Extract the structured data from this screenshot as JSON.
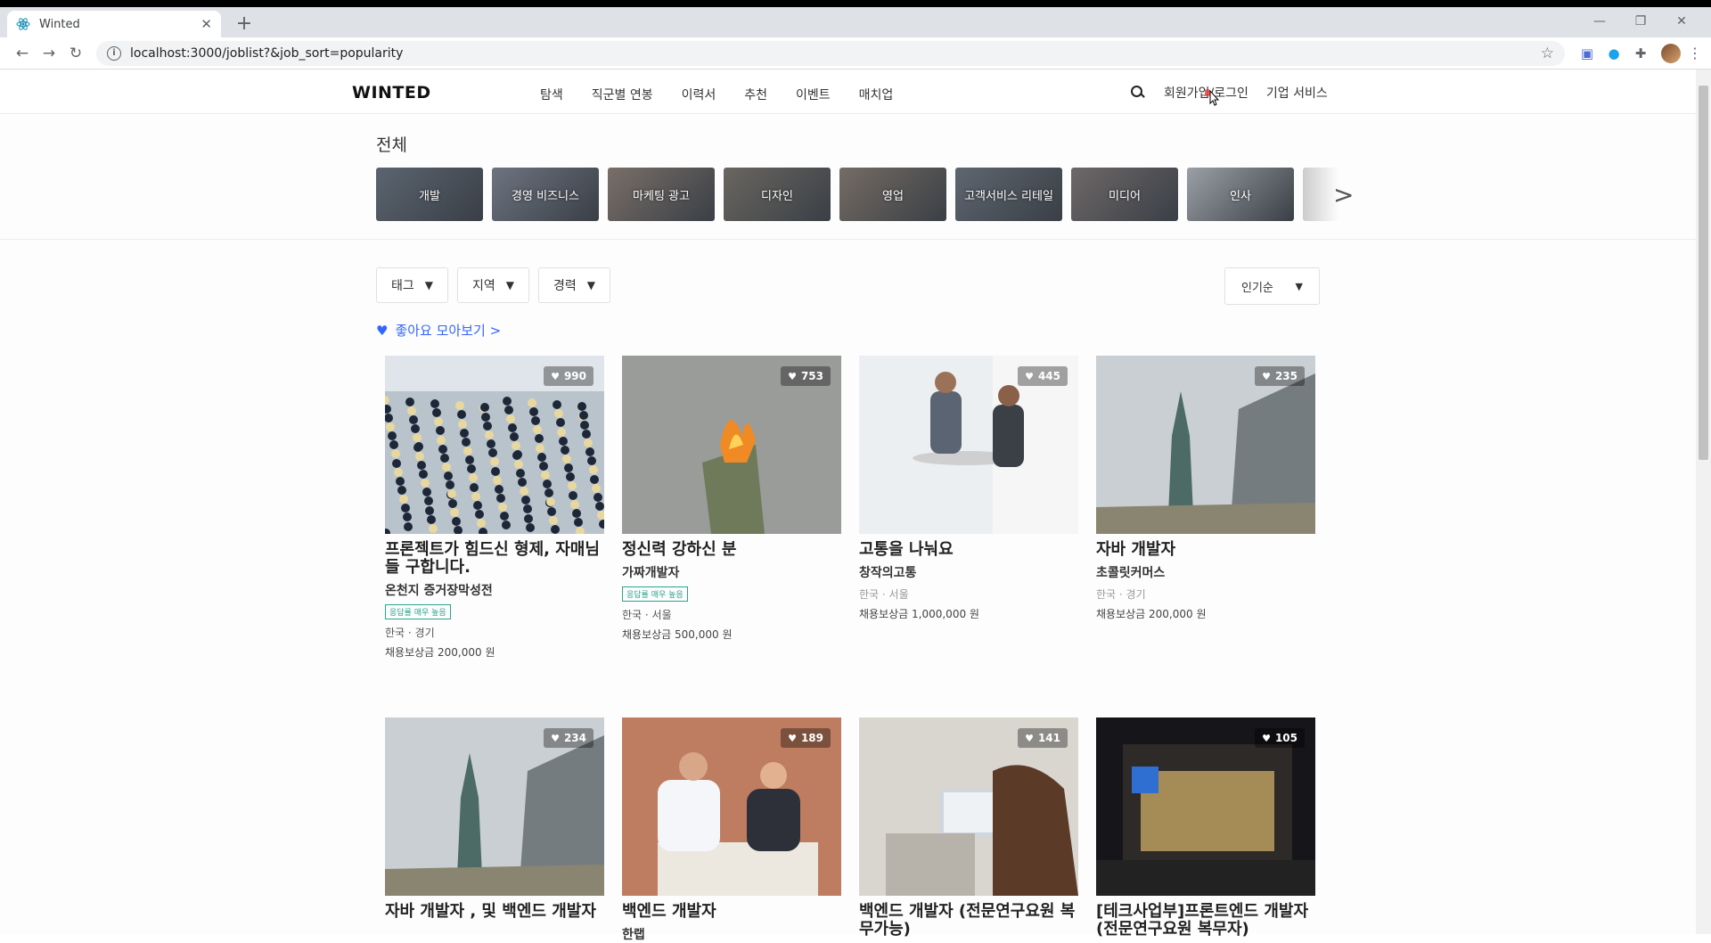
{
  "browser": {
    "tab_title": "Winted",
    "url": "localhost:3000/joblist?&job_sort=popularity"
  },
  "header": {
    "logo": "WINTED",
    "nav": [
      "탐색",
      "직군별 연봉",
      "이력서",
      "추천",
      "이벤트",
      "매치업"
    ],
    "auth": "회원가입/로그인",
    "business": "기업 서비스"
  },
  "category": {
    "title": "전체",
    "items": [
      {
        "label": "개발",
        "color": "#5b6470"
      },
      {
        "label": "경영 비즈니스",
        "color": "#6d7480"
      },
      {
        "label": "마케팅 광고",
        "color": "#7a6f68"
      },
      {
        "label": "디자인",
        "color": "#6a6660"
      },
      {
        "label": "영업",
        "color": "#756c64"
      },
      {
        "label": "고객서비스 리테일",
        "color": "#5e6670"
      },
      {
        "label": "미디어",
        "color": "#6e6868"
      },
      {
        "label": "인사",
        "color": "#9aa0a6"
      }
    ]
  },
  "filters": {
    "tag": "태그",
    "region": "지역",
    "career": "경력",
    "sort": "인기순"
  },
  "like_collect": "좋아요 모아보기 >",
  "jobs": [
    {
      "likes": "990",
      "title": "프론젝트가 힘드신 형제, 자매님들 구합니다.",
      "company": "온천지 증거장막성전",
      "badge": "응답률 매우 높음",
      "location": "한국 · 경기",
      "reward": "채용보상금 200,000 원",
      "theme": "crowd"
    },
    {
      "likes": "753",
      "title": "정신력 강하신 분",
      "company": "가짜개발자",
      "badge": "응답률 매우 높음",
      "location": "한국 · 서울",
      "reward": "채용보상금 500,000 원",
      "theme": "fire"
    },
    {
      "likes": "445",
      "title": "고통을 나눠요",
      "company": "창작의고통",
      "badge": "",
      "location": "한국 · 서울",
      "reward": "채용보상금 1,000,000 원",
      "theme": "office"
    },
    {
      "likes": "235",
      "title": "자바 개발자",
      "company": "초콜릿커머스",
      "badge": "",
      "location": "한국 · 경기",
      "reward": "채용보상금 200,000 원",
      "theme": "tower"
    },
    {
      "likes": "234",
      "title": "자바 개발자 , 및 백엔드 개발자",
      "company": "",
      "badge": "",
      "location": "",
      "reward": "",
      "theme": "tower"
    },
    {
      "likes": "189",
      "title": "백엔드 개발자",
      "company": "한랩",
      "badge": "",
      "location": "",
      "reward": "",
      "theme": "meeting"
    },
    {
      "likes": "141",
      "title": "백엔드 개발자 (전문연구요원 복무가능)",
      "company": "",
      "badge": "",
      "location": "",
      "reward": "",
      "theme": "laptop"
    },
    {
      "likes": "105",
      "title": "[테크사업부]프론트엔드 개발자(전문연구요원 복무자)",
      "company": "",
      "badge": "",
      "location": "",
      "reward": "",
      "theme": "night"
    }
  ]
}
